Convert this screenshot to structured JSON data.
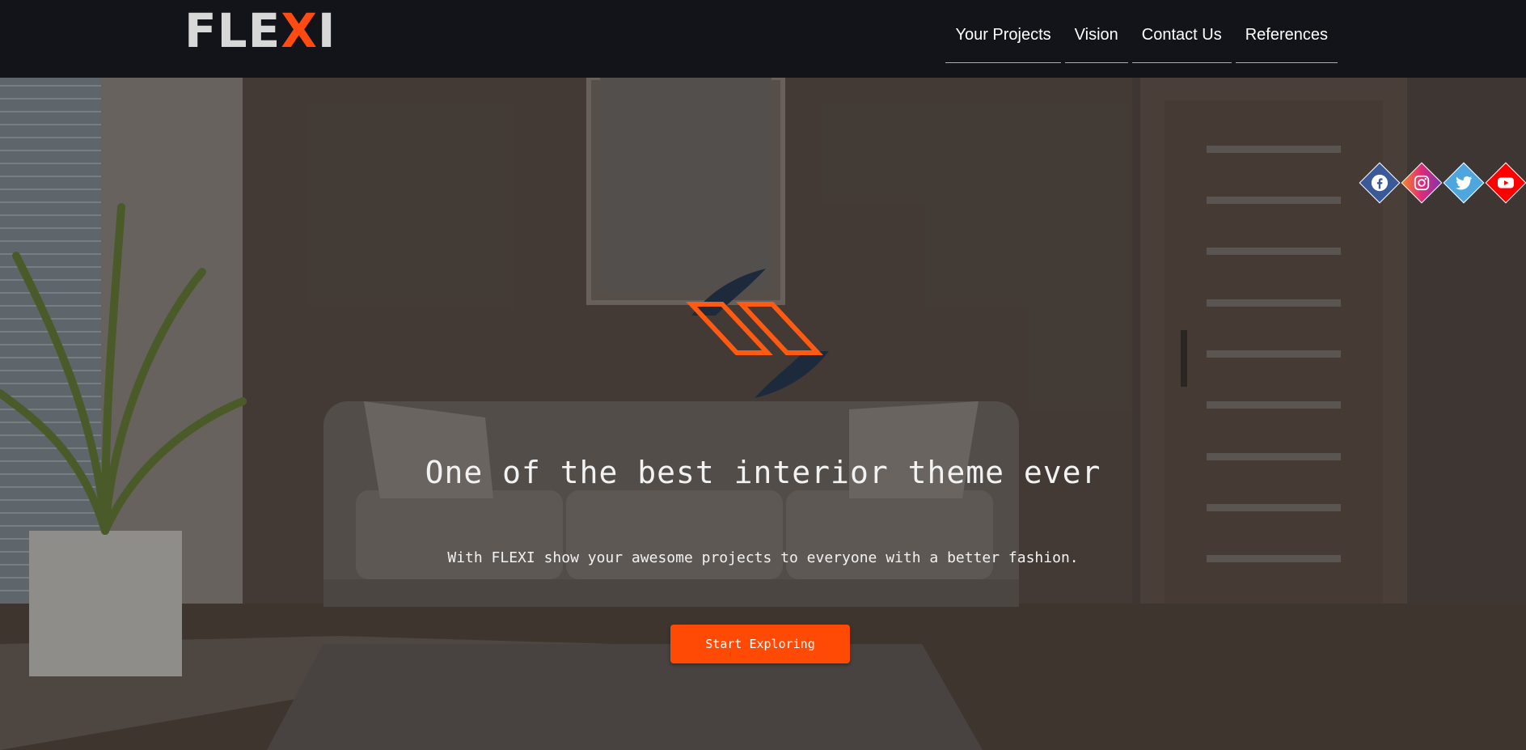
{
  "brand": {
    "logo_part1": "FLE",
    "logo_x": "X",
    "logo_part2": "I",
    "accent": "#ff4a12"
  },
  "nav": {
    "items": [
      {
        "label": "Your Projects"
      },
      {
        "label": "Vision"
      },
      {
        "label": "Contact Us"
      },
      {
        "label": "References"
      }
    ],
    "underline_color": "#d4b03a"
  },
  "social": [
    {
      "icon": "facebook-icon",
      "color": "#3b5998"
    },
    {
      "icon": "instagram-icon",
      "color": "#c13584"
    },
    {
      "icon": "twitter-icon",
      "color": "#4da7de"
    },
    {
      "icon": "youtube-icon",
      "color": "#ff0000"
    }
  ],
  "hero": {
    "title": "One of the best interior theme ever",
    "subtitle": "With FLEXI show your awesome projects to everyone with a better fashion.",
    "cta_label": "Start Exploring",
    "cta_color": "#ff4a05"
  }
}
